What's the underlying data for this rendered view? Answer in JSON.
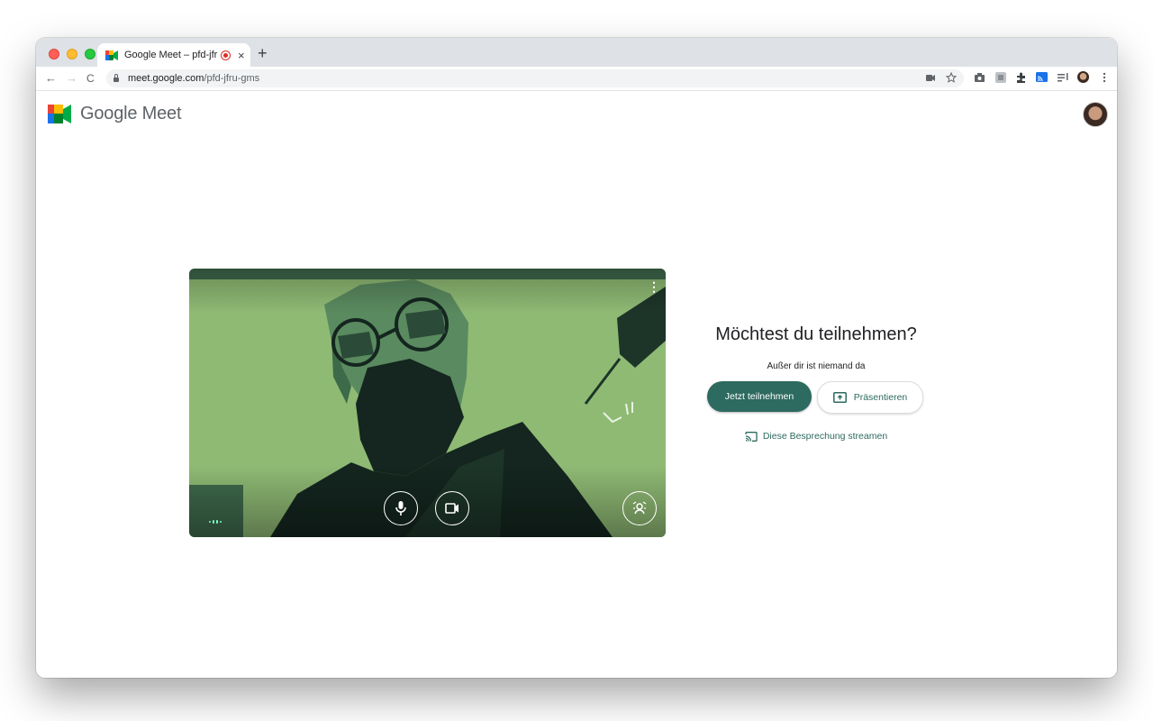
{
  "browser": {
    "tab": {
      "title": "Google Meet – pfd-jfru-gms",
      "close_glyph": "×",
      "recording_icon": "recording-dot-icon"
    },
    "new_tab_glyph": "+",
    "nav": {
      "back": "←",
      "forward": "→",
      "reload": "C"
    },
    "address": {
      "host": "meet.google.com",
      "path": "/pfd-jfru-gms"
    },
    "omnibox_icons": [
      "camera-in-use-icon",
      "bookmark-star-icon"
    ],
    "extension_icons": [
      "screenshot-icon",
      "extension-grey-icon",
      "puzzle-icon",
      "cast-icon",
      "reading-list-icon",
      "profile-avatar-icon",
      "menu-dots-icon"
    ]
  },
  "header": {
    "logo_text": "Google Meet"
  },
  "video": {
    "more_glyph": "⋮",
    "controls": [
      "microphone-icon",
      "camera-icon",
      "background-effects-icon"
    ]
  },
  "join": {
    "title": "Möchtest du teilnehmen?",
    "subtitle": "Außer dir ist niemand da",
    "join_button": "Jetzt teilnehmen",
    "present_button": "Präsentieren",
    "stream_link": "Diese Besprechung streamen"
  },
  "colors": {
    "accent": "#2d6a5f",
    "video_green": "#8fba74",
    "video_dark": "#14261f"
  }
}
